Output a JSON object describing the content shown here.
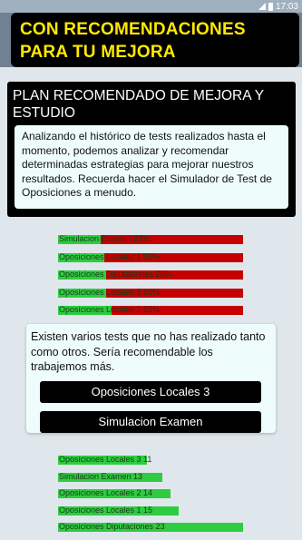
{
  "status_bar": {
    "time": "17:03"
  },
  "banner": {
    "title": "CON RECOMENDACIONES PARA TU MEJORA"
  },
  "plan": {
    "title": "PLAN RECOMENDADO DE MEJORA Y ESTUDIO",
    "body": "Analizando el histórico de tests realizados hasta el momento, podemos analizar y recomendar determinadas estrategias para mejorar nuestros resultados. Recuerda hacer el Simulador de Test de Oposiciones a menudo."
  },
  "colors": {
    "success": "#2ecc40",
    "fail": "#c40000",
    "label": "#1a3a18"
  },
  "chart_data": [
    {
      "type": "bar",
      "orientation": "horizontal",
      "categories": [
        "Simulacion Examen 23%",
        "Oposiciones Locales 1 25%",
        "Oposiciones Diputaciones 26%",
        "Oposiciones Locales 3 26%",
        "Oposiciones Locales 2 29%"
      ],
      "series": [
        {
          "values": [
            23,
            25,
            26,
            26,
            29
          ]
        }
      ],
      "xlim": [
        0,
        100
      ]
    },
    {
      "type": "bar",
      "orientation": "horizontal",
      "categories": [
        "Oposiciones Locales 3 11",
        "Simulacion Examen 13",
        "Oposiciones Locales 2 14",
        "Oposiciones Locales 1 15",
        "Oposiciones Diputaciones 23"
      ],
      "series": [
        {
          "values": [
            11,
            13,
            14,
            15,
            23
          ]
        }
      ],
      "xlim": [
        0,
        23
      ]
    }
  ],
  "recommendation": {
    "text": "Existen varios tests que no has realizado tanto como otros. Sería recomendable los trabajemos más.",
    "buttons": [
      "Oposiciones Locales 3",
      "Simulacion Examen"
    ]
  }
}
